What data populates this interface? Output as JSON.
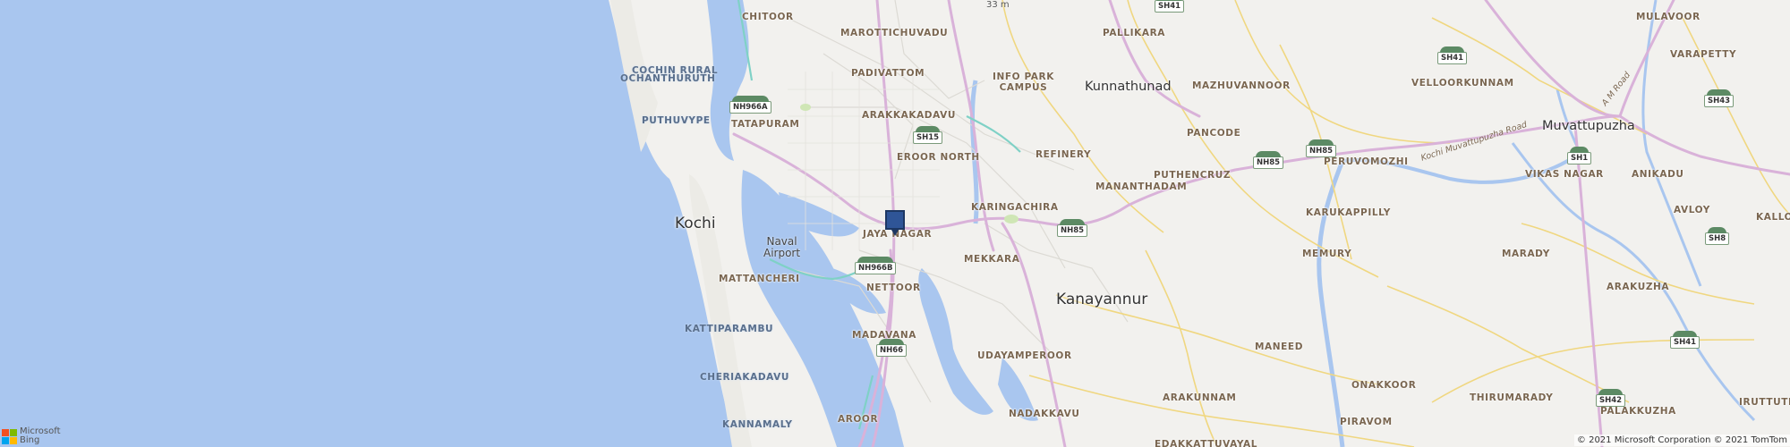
{
  "places": {
    "kochi": "Kochi",
    "naval_airport": "Naval\nAirport",
    "kunnathunad": "Kunnathunad",
    "kanayannur": "Kanayannur",
    "muvattupuzha": "Muvattupuzha",
    "chitoor": "CHITOOR",
    "marottichuvadu": "MAROTTICHUVADU",
    "pallikara": "PALLIKARA",
    "mulavoor": "MULAVOOR",
    "cochin_rural": "COCHIN RURAL",
    "ochanthuruth": "OCHANTHURUTH",
    "padivattom": "PADIVATTOM",
    "info_park_campus": "INFO PARK\nCAMPUS",
    "varapetty": "VARAPETTY",
    "mazhuvannoor": "MAZHUVANNOOR",
    "velloorkunnam": "VELLOORKUNNAM",
    "puthuvype": "PUTHUVYPE",
    "tatapuram": "TATAPURAM",
    "arakkakadavu": "ARAKKAKADAVU",
    "pancode": "PANCODE",
    "eroor_north": "EROOR NORTH",
    "refinery": "REFINERY",
    "peruvomozhi": "PERUVOMOZHI",
    "puthencruz": "PUTHENCRUZ",
    "mananthadam": "MANANTHADAM",
    "vikas_nagar": "VIKAS NAGAR",
    "anikadu": "ANIKADU",
    "karingachira": "KARINGACHIRA",
    "karukappilly": "KARUKAPPILLY",
    "avloy": "AVLOY",
    "kalloorkad": "KALLOORKAD",
    "jaya_nagar": "JAYA NAGAR",
    "mattancheri": "MATTANCHERI",
    "mekkara": "MEKKARA",
    "memury": "MEMURY",
    "marady": "MARADY",
    "nettoor": "NETTOOR",
    "arakuzha": "ARAKUZHA",
    "kattiparambu": "KATTIPARAMBU",
    "madavana": "MADAVANA",
    "maneed": "MANEED",
    "udayamperoor": "UDAYAMPEROOR",
    "cheriakadavu": "CHERIAKADAVU",
    "onakkoor": "ONAKKOOR",
    "arakunnam": "ARAKUNNAM",
    "thirumarady": "THIRUMARADY",
    "palakkuzha": "PALAKKUZHA",
    "iruttuthara": "IRUTTUTH",
    "nadakkavu": "NADAKKAVU",
    "kannamaly": "KANNAMALY",
    "aroor": "AROOR",
    "piravom": "PIRAVOM",
    "edakkattuvayal": "EDAKKATTUVAYAL",
    "elevation": "33 m"
  },
  "road_labels": {
    "kochi_muvattupuzha_road": "Kochi Muvattupuzha Road",
    "am_road": "A M Road"
  },
  "shields": {
    "sh41_top": "SH41",
    "sh41_right": "SH41",
    "sh43": "SH43",
    "nh966a": "NH966A",
    "sh15": "SH15",
    "nh85_a": "NH85",
    "nh85_b": "NH85",
    "nh85_c": "NH85",
    "sh1": "SH1",
    "sh8": "SH8",
    "nh966b": "NH966B",
    "nh66": "NH66",
    "sh41_bottom": "SH41",
    "sh42": "SH42"
  },
  "brand": {
    "line1": "Microsoft",
    "line2": "Bing"
  },
  "copyright": "© 2021 Microsoft Corporation © 2021 TomTom",
  "colors": {
    "water": "#a9c6ef",
    "land": "#f2f1ee",
    "highway": "#d9b2d9",
    "major_road": "#f0d780",
    "marker": "#2f5597"
  }
}
